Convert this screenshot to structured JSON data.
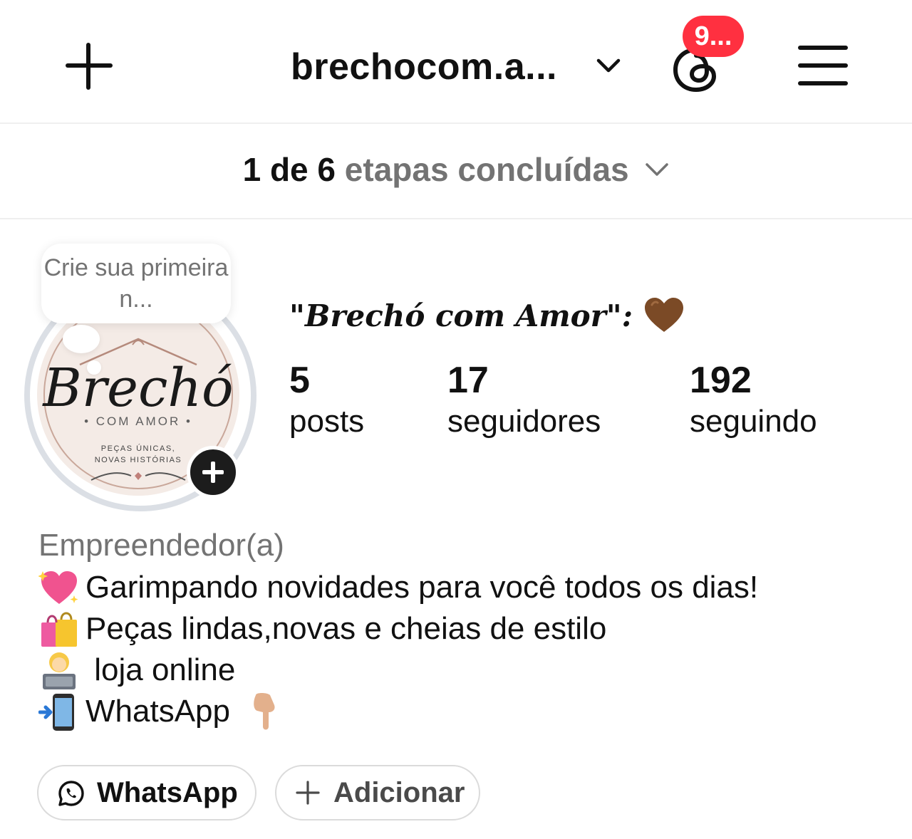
{
  "header": {
    "username": "brechocom.a...",
    "threads_badge": "9..."
  },
  "steps": {
    "done": "1 de 6",
    "label": "etapas concluídas"
  },
  "note": {
    "text": "Crie sua primeira n..."
  },
  "avatar": {
    "logo_script": "Brechó",
    "logo_sub": "• COM AMOR •",
    "logo_tag": "PEÇAS ÚNICAS,\nNOVAS HISTÓRIAS"
  },
  "profile": {
    "display_name": "\"Brechó com Amor\":",
    "stats": [
      {
        "value": "5",
        "label": "posts"
      },
      {
        "value": "17",
        "label": "seguidores"
      },
      {
        "value": "192",
        "label": "seguindo"
      }
    ],
    "category": "Empreendedor(a)",
    "bio": [
      {
        "icon": "sparkling-heart-emoji",
        "text": "Garimpando novidades para você todos os dias!"
      },
      {
        "icon": "shopping-bags-emoji",
        "text": "Peças lindas,novas e cheias de estilo"
      },
      {
        "icon": "technologist-emoji",
        "text": " loja online"
      },
      {
        "icon": "mobile-arrow-emoji",
        "text": "WhatsApp"
      }
    ]
  },
  "buttons": {
    "whatsapp": "WhatsApp",
    "add": "Adicionar"
  },
  "colors": {
    "badge": "#ff3040",
    "muted": "#737373",
    "divider": "#efefef"
  }
}
